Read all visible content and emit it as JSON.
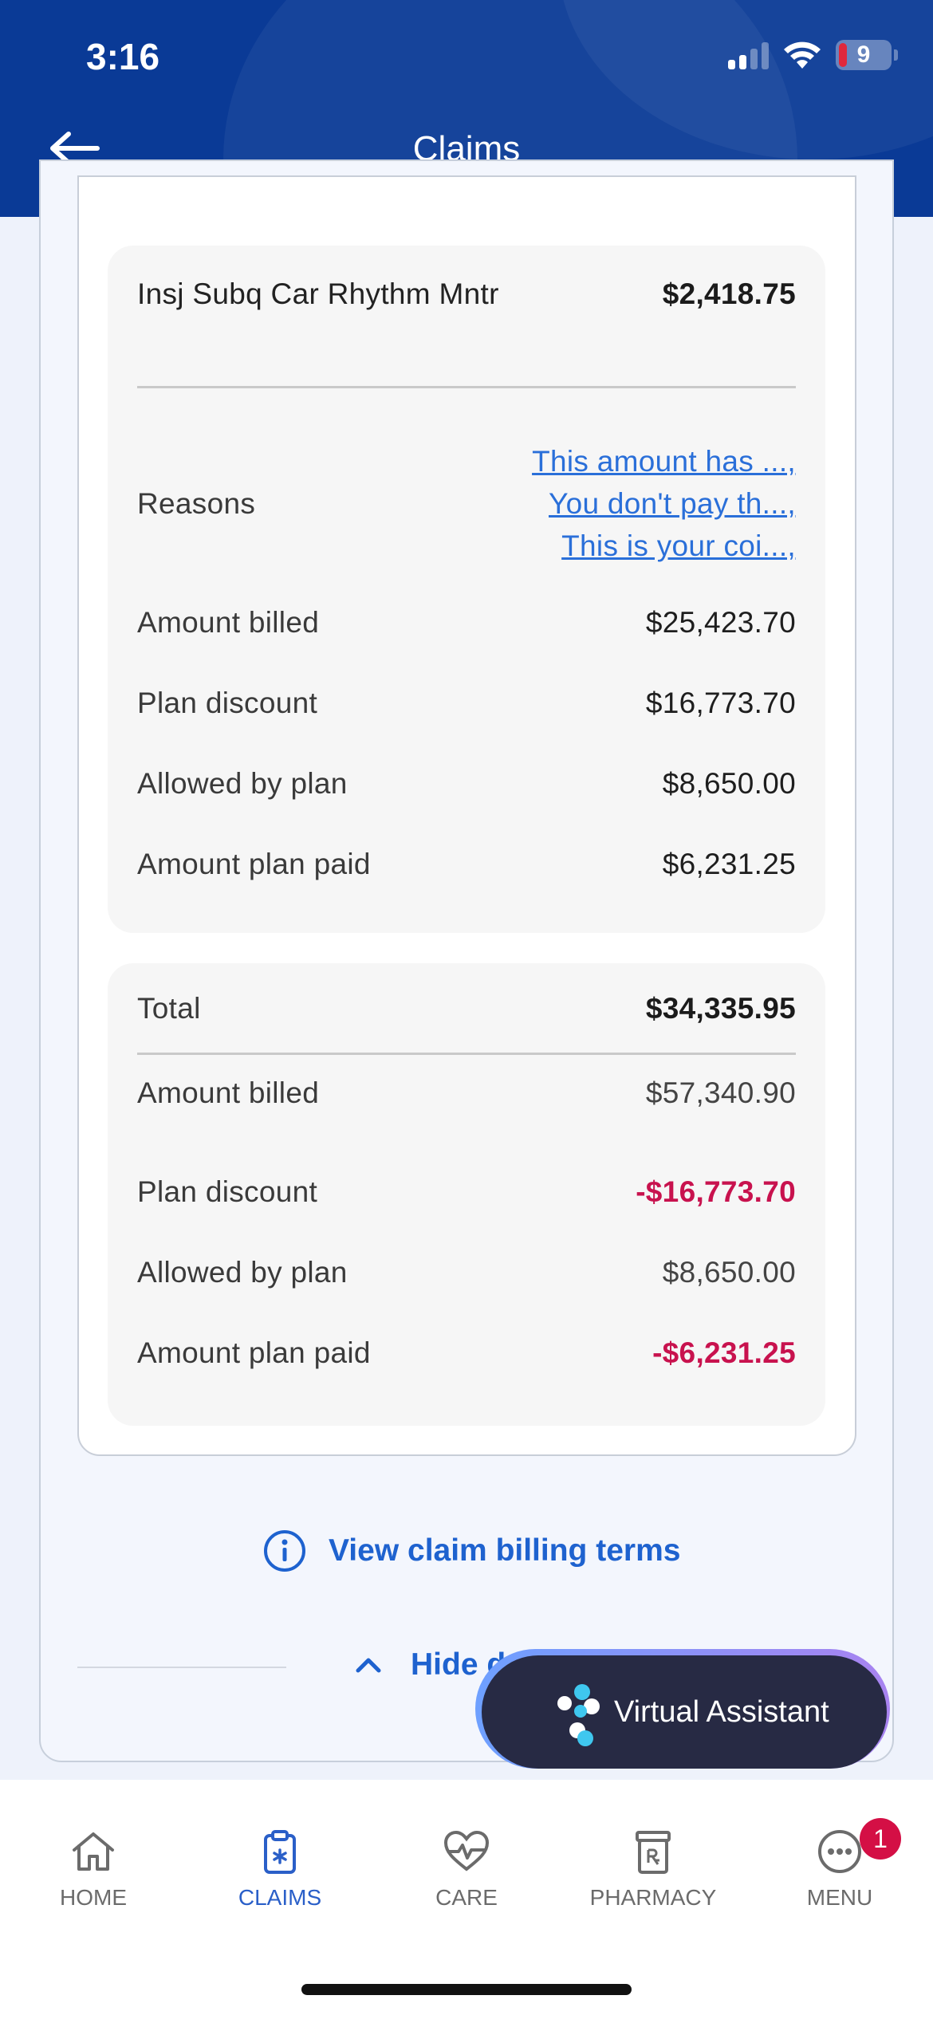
{
  "status_bar": {
    "time": "3:16",
    "battery": "9"
  },
  "header": {
    "title": "Claims"
  },
  "line_item": {
    "service": "Insj Subq Car Rhythm Mntr",
    "amount": "$2,418.75",
    "reasons_label": "Reasons",
    "reasons": [
      "This amount has ...,",
      "You don't pay th...,",
      "This is your coi...,"
    ],
    "amount_billed_label": "Amount billed",
    "amount_billed": "$25,423.70",
    "plan_discount_label": "Plan discount",
    "plan_discount": "$16,773.70",
    "allowed_label": "Allowed by plan",
    "allowed": "$8,650.00",
    "plan_paid_label": "Amount plan paid",
    "plan_paid": "$6,231.25"
  },
  "totals": {
    "total_label": "Total",
    "total": "$34,335.95",
    "amount_billed_label": "Amount billed",
    "amount_billed": "$57,340.90",
    "plan_discount_label": "Plan discount",
    "plan_discount": "-$16,773.70",
    "allowed_label": "Allowed by plan",
    "allowed": "$8,650.00",
    "plan_paid_label": "Amount plan paid",
    "plan_paid": "-$6,231.25"
  },
  "links": {
    "billing_terms": "View claim billing terms",
    "hide_details": "Hide d"
  },
  "virtual_assistant": {
    "label": "Virtual Assistant"
  },
  "bottom_nav": {
    "items": [
      {
        "label": "HOME",
        "icon": "home-icon"
      },
      {
        "label": "CLAIMS",
        "icon": "clipboard-icon"
      },
      {
        "label": "CARE",
        "icon": "heart-pulse-icon"
      },
      {
        "label": "PHARMACY",
        "icon": "pharmacy-icon"
      },
      {
        "label": "MENU",
        "icon": "menu-dots-icon"
      }
    ],
    "menu_badge": "1",
    "active": "CLAIMS"
  },
  "colors": {
    "header_bg": "#0a3a96",
    "link": "#2a6fd9",
    "negative": "#c8124e",
    "active_nav": "#2a5fc8",
    "badge": "#d40f45"
  }
}
